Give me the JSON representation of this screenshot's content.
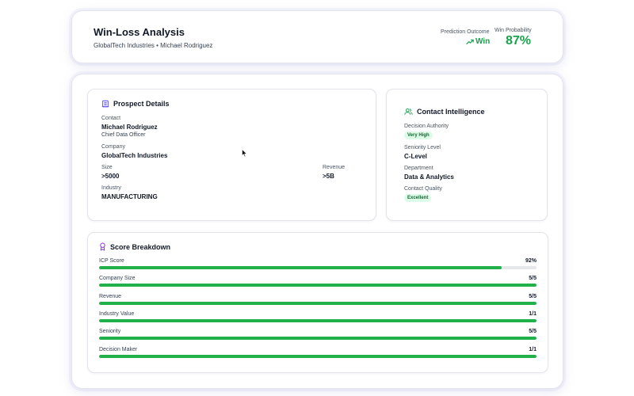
{
  "header": {
    "title": "Win-Loss Analysis",
    "subtitle": "GlobalTech Industries • Michael Rodriguez",
    "prediction_label": "Prediction Outcome",
    "prediction_value": "Win",
    "probability_label": "Win Probability",
    "probability_value": "87%"
  },
  "prospect": {
    "title": "Prospect Details",
    "contact_label": "Contact",
    "contact_name": "Michael Rodriguez",
    "contact_role": "Chief Data Officer",
    "company_label": "Company",
    "company_name": "GlobalTech Industries",
    "size_label": "Size",
    "size_value": ">5000",
    "revenue_label": "Revenue",
    "revenue_value": ">5B",
    "industry_label": "Industry",
    "industry_value": "MANUFACTURING"
  },
  "contact_intel": {
    "title": "Contact Intelligence",
    "authority_label": "Decision Authority",
    "authority_value": "Very High",
    "seniority_label": "Seniority Level",
    "seniority_value": "C-Level",
    "department_label": "Department",
    "department_value": "Data & Analytics",
    "quality_label": "Contact Quality",
    "quality_value": "Excellent"
  },
  "score": {
    "title": "Score Breakdown",
    "rows": [
      {
        "label": "ICP Score",
        "value": "92%",
        "fraction": 0.92
      },
      {
        "label": "Company Size",
        "value": "5/5",
        "fraction": 1.0
      },
      {
        "label": "Revenue",
        "value": "5/5",
        "fraction": 1.0
      },
      {
        "label": "Industry Value",
        "value": "1/1",
        "fraction": 1.0
      },
      {
        "label": "Seniority",
        "value": "5/5",
        "fraction": 1.0
      },
      {
        "label": "Decision Maker",
        "value": "1/1",
        "fraction": 1.0
      }
    ]
  },
  "colors": {
    "accent_green": "#16a34a",
    "bar_green": "#22b04b",
    "badge_bg": "#dcfce7",
    "badge_text": "#166534"
  },
  "icons": {
    "prediction": "trending-up-icon",
    "prospect": "building-icon",
    "contact": "users-icon",
    "score": "award-icon"
  }
}
